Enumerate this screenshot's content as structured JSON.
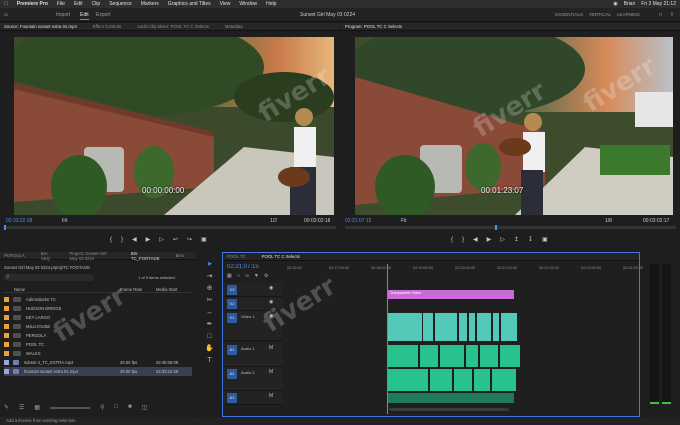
{
  "menubar": {
    "app": "Premiere Pro",
    "items": [
      "File",
      "Edit",
      "Clip",
      "Sequence",
      "Markers",
      "Graphics and Titles",
      "View",
      "Window",
      "Help"
    ],
    "user": "Brian",
    "clock": "Fri 3 May  21:12"
  },
  "workspace": {
    "tabs": [
      "Import",
      "Edit",
      "Export"
    ],
    "active_tab": "Edit",
    "title": "Sunset Girl May 03 0224",
    "links": [
      "ESSENTIALS",
      "VERTICAL",
      "LEARNING"
    ]
  },
  "source_panel": {
    "tabs": [
      "Source: Fountain sunset extra 01.mp4",
      "Effect Controls",
      "Audio Clip Mixer: POOL TC C Selects",
      "Metadata"
    ],
    "overlay_timecode": "00:00:00:00",
    "current_timecode": "02:33:22:28",
    "fit": "Fit",
    "ratio": "1/2",
    "duration": "00:03:02:18"
  },
  "program_panel": {
    "tab": "Program: POOL TC C Selects",
    "overlay_timecode": "00:01:23:07",
    "current_timecode": "02:21:07:15",
    "fit": "Fit",
    "ratio": "1/8",
    "duration": "00:03:02:17"
  },
  "project_panel": {
    "tabs": [
      "PERGOLA",
      "Bin: SEQ",
      "Project: Sunset Girl May 03 0224",
      "Bin: TC_FOOTAGE",
      "Bins"
    ],
    "path": "Sunset Girl May 03 0224.prproj\\TC FOOTAGE",
    "selected_info": "1 of 9 items selected",
    "columns": [
      "Name",
      "Frame Rate",
      "Media Start"
    ],
    "rows": [
      {
        "name": "Adirondacks TC",
        "type": "folder",
        "color": "#e8a33c",
        "fps": "",
        "start": ""
      },
      {
        "name": "HUDSON BRIDGE",
        "type": "folder",
        "color": "#e8a33c",
        "fps": "",
        "start": ""
      },
      {
        "name": "KEY LARGO",
        "type": "folder",
        "color": "#e8a33c",
        "fps": "",
        "start": ""
      },
      {
        "name": "MILLHOUSE",
        "type": "folder",
        "color": "#e8a33c",
        "fps": "",
        "start": ""
      },
      {
        "name": "PERGOLA",
        "type": "folder",
        "color": "#e8a33c",
        "fps": "",
        "start": ""
      },
      {
        "name": "POOL TC",
        "type": "folder",
        "color": "#e8a33c",
        "fps": "",
        "start": ""
      },
      {
        "name": "WALKS",
        "type": "folder",
        "color": "#e8a33c",
        "fps": "",
        "start": ""
      },
      {
        "name": "subset 4_TC_EXTRA.mp4",
        "type": "clip",
        "color": "#9aa7d6",
        "fps": "30.00 fps",
        "start": "02:45:06:08"
      },
      {
        "name": "fountain sunset extra 01.mp4",
        "type": "clip",
        "color": "#9aa7d6",
        "fps": "30.00 fps",
        "start": "02:33:22:28"
      }
    ]
  },
  "timeline": {
    "tabs": [
      "POOL TC",
      "POOL TC C Selects"
    ],
    "timecode": "02:21:07:15",
    "ruler": [
      "02:16:00",
      "02:17:00:00",
      "02:18:00:00",
      "02:19:00:00",
      "02:20:00:00",
      "02:21:00:00",
      "02:22:00:00",
      "02:23:00:00",
      "02:24:00:00"
    ],
    "tracks": [
      {
        "id": "V3",
        "label": "",
        "kind": "video"
      },
      {
        "id": "V2",
        "label": "",
        "kind": "video"
      },
      {
        "id": "V1",
        "label": "Video 1",
        "kind": "video"
      },
      {
        "id": "A1",
        "label": "Audio 1",
        "kind": "audio"
      },
      {
        "id": "A2",
        "label": "Audio 2",
        "kind": "audio"
      },
      {
        "id": "A3",
        "label": "",
        "kind": "audio"
      }
    ],
    "title_clip": "Transparent Video",
    "colors": {
      "title": "#c96cd6",
      "video": "#53c9b7",
      "audio": "#27c28e",
      "selection": "#4276e0"
    }
  },
  "statusbar": {
    "text": "Add a license from existing selection"
  },
  "watermark": "fiverr"
}
